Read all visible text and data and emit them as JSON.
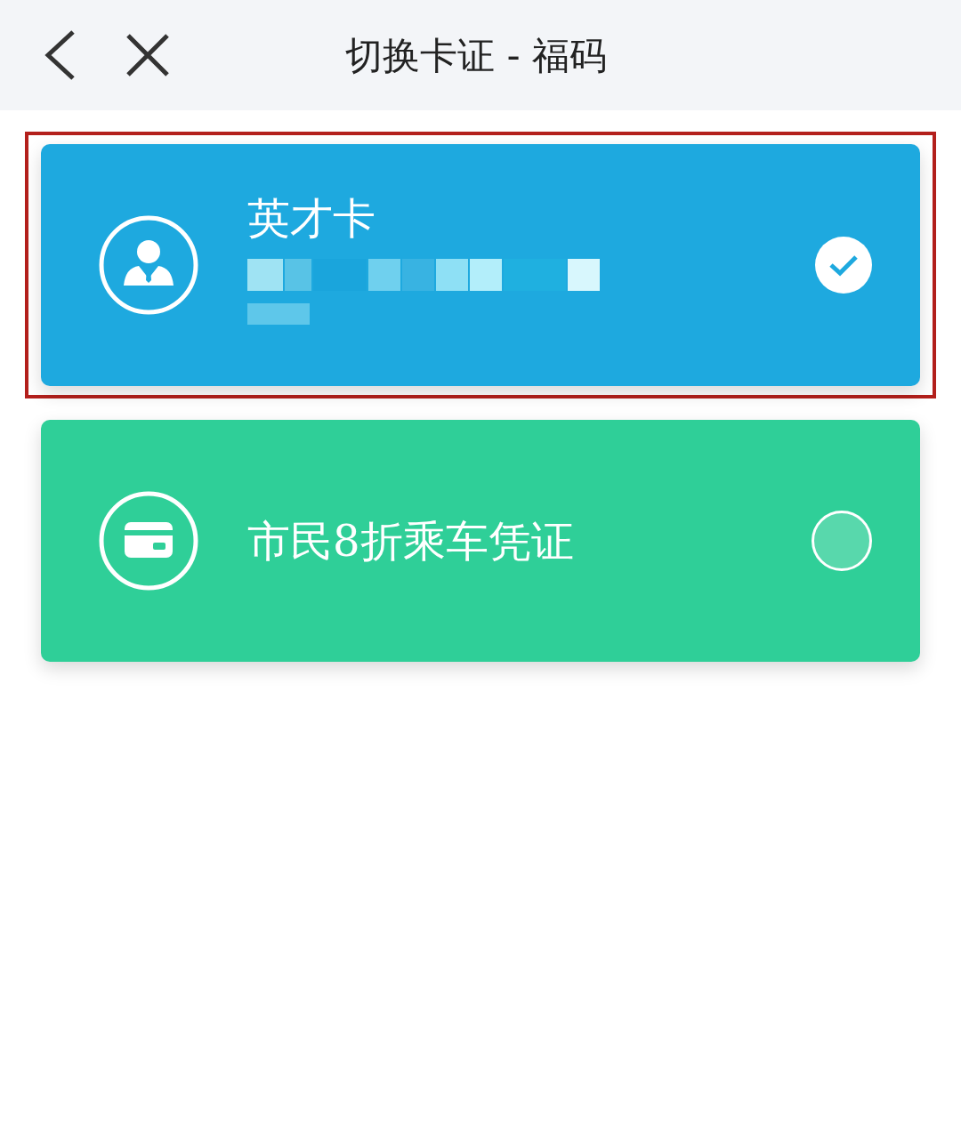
{
  "header": {
    "title": "切换卡证 - 福码"
  },
  "cards": [
    {
      "name": "英才卡",
      "kind": "person",
      "color": "#1ea9df",
      "selected": true,
      "highlighted": true,
      "redacted": true
    },
    {
      "name": "市民8折乘车凭证",
      "kind": "card",
      "color": "#2fcf98",
      "selected": false,
      "highlighted": false,
      "redacted": false
    }
  ]
}
